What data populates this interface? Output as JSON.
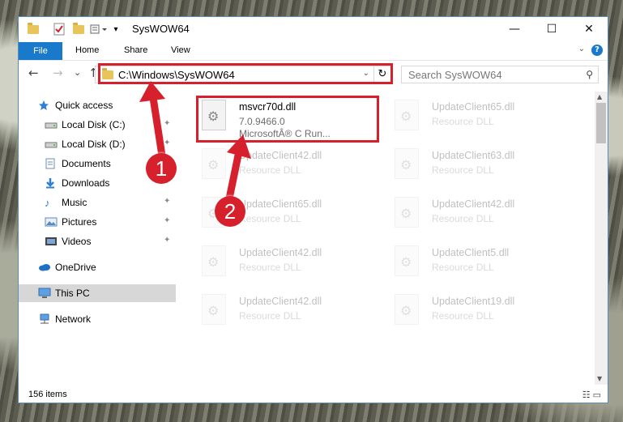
{
  "window": {
    "title": "SysWOW64",
    "minimize_glyph": "—",
    "maximize_glyph": "☐",
    "close_glyph": "✕"
  },
  "ribbon": {
    "file": "File",
    "home": "Home",
    "share": "Share",
    "view": "View",
    "help": "?",
    "expand_glyph": "⌄"
  },
  "nav": {
    "back_glyph": "←",
    "forward_glyph": "→",
    "recent_glyph": "⌄",
    "up_glyph": "↑",
    "address": "C:\\Windows\\SysWOW64",
    "refresh_glyph": "↻",
    "search_placeholder": "Search SysWOW64",
    "search_icon": "⚲"
  },
  "sidebar": {
    "items": [
      {
        "label": "Quick access",
        "icon": "star-icon"
      },
      {
        "label": "Local Disk (C:)",
        "icon": "drive-icon"
      },
      {
        "label": "Local Disk (D:)",
        "icon": "drive-icon"
      },
      {
        "label": "Documents",
        "icon": "documents-icon"
      },
      {
        "label": "Downloads",
        "icon": "downloads-icon"
      },
      {
        "label": "Music",
        "icon": "music-icon"
      },
      {
        "label": "Pictures",
        "icon": "pictures-icon"
      },
      {
        "label": "Videos",
        "icon": "videos-icon"
      },
      {
        "label": "OneDrive",
        "icon": "onedrive-icon"
      },
      {
        "label": "This PC",
        "icon": "pc-icon"
      },
      {
        "label": "Network",
        "icon": "network-icon"
      }
    ],
    "pin_glyph": "✦"
  },
  "files": [
    {
      "name": "msvcr70d.dll",
      "line2": "7.0.9466.0",
      "line3": "MicrosoftÂ® C Run..."
    },
    {
      "name": "UpdateClient65.dll",
      "line2": "Resource DLL"
    },
    {
      "name": "UpdateClient42.dll",
      "line2": "Resource DLL"
    },
    {
      "name": "UpdateClient63.dll",
      "line2": "Resource DLL"
    },
    {
      "name": "UpdateClient65.dll",
      "line2": "Resource DLL"
    },
    {
      "name": "UpdateClient42.dll",
      "line2": "Resource DLL"
    },
    {
      "name": "UpdateClient42.dll",
      "line2": "Resource DLL"
    },
    {
      "name": "UpdateClient5.dll",
      "line2": "Resource DLL"
    },
    {
      "name": "UpdateClient42.dll",
      "line2": "Resource DLL"
    },
    {
      "name": "UpdateClient19.dll",
      "line2": "Resource DLL"
    }
  ],
  "status": {
    "count": "156 items",
    "views_glyph": "☷ ▭"
  },
  "annotations": {
    "step1": "1",
    "step2": "2",
    "color": "#d6202c"
  },
  "scroll": {
    "up_glyph": "▲",
    "down_glyph": "▼"
  }
}
